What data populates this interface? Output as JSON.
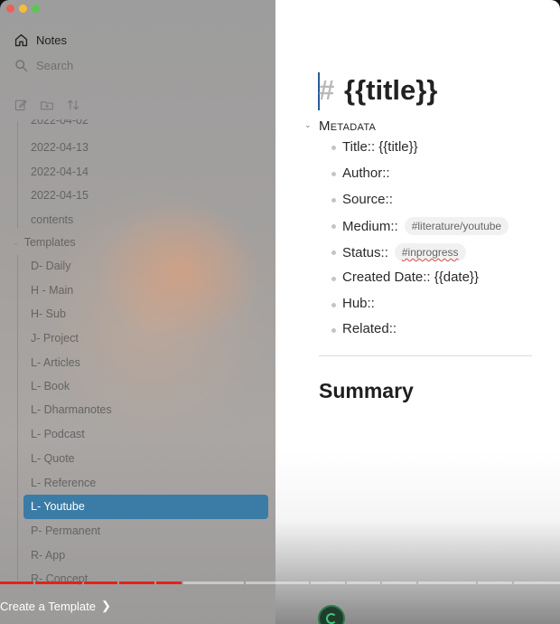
{
  "sidebar": {
    "notes_label": "Notes",
    "search_label": "Search",
    "partial_date": "2022-04-02",
    "notes": [
      "2022-04-13",
      "2022-04-14",
      "2022-04-15",
      "contents"
    ],
    "templates_folder": "Templates",
    "templates": [
      "D- Daily",
      "H - Main",
      "H- Sub",
      "J- Project",
      "L- Articles",
      "L- Book",
      "L- Dharmanotes",
      "L- Podcast",
      "L- Quote",
      "L- Reference",
      "L- Youtube",
      "P- Permanent",
      "R- App",
      "R- Concept"
    ],
    "selected_template": "L- Youtube"
  },
  "editor": {
    "heading_hash": "#",
    "heading_title": "{{title}}",
    "metadata_heading": "Metadata",
    "properties": [
      {
        "label": "Title:: {{title}}",
        "tag": ""
      },
      {
        "label": "Author::",
        "tag": ""
      },
      {
        "label": "Source::",
        "tag": ""
      },
      {
        "label": "Medium::",
        "tag": "#literature/youtube"
      },
      {
        "label": "Status::",
        "tag": "#inprogress"
      },
      {
        "label": "Created Date:: {{date}}",
        "tag": ""
      },
      {
        "label": "Hub::",
        "tag": ""
      },
      {
        "label": "Related::",
        "tag": ""
      }
    ],
    "summary_heading": "Summary"
  },
  "video": {
    "chapter_title": "Create a Template",
    "played_fraction": 0.36
  },
  "colors": {
    "selection": "#3a7ca5",
    "progress_played": "#e62117"
  }
}
